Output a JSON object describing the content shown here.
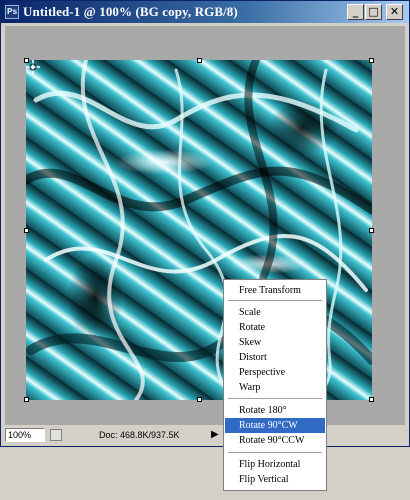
{
  "window": {
    "title": "Untitled-1 @ 100% (BG copy, RGB/8)",
    "app_icon": "Ps",
    "buttons": {
      "minimize": "_",
      "maximize": "□",
      "close": "✕"
    }
  },
  "status_bar": {
    "zoom": "100%",
    "doc_info": "Doc: 468.8K/937.5K",
    "arrow": "▶"
  },
  "context_menu": {
    "items": [
      {
        "label": "Free Transform",
        "selected": false
      },
      {
        "label": "Scale",
        "selected": false
      },
      {
        "label": "Rotate",
        "selected": false
      },
      {
        "label": "Skew",
        "selected": false
      },
      {
        "label": "Distort",
        "selected": false
      },
      {
        "label": "Perspective",
        "selected": false
      },
      {
        "label": "Warp",
        "selected": false
      },
      {
        "label": "Rotate 180°",
        "selected": false
      },
      {
        "label": "Rotate 90°CW",
        "selected": true
      },
      {
        "label": "Rotate 90°CCW",
        "selected": false
      },
      {
        "label": "Flip Horizontal",
        "selected": false
      },
      {
        "label": "Flip Vertical",
        "selected": false
      }
    ]
  },
  "colors": {
    "title_bar": "#0a246a",
    "selection": "#316ac5",
    "canvas_accent": "#2aa9b8"
  }
}
